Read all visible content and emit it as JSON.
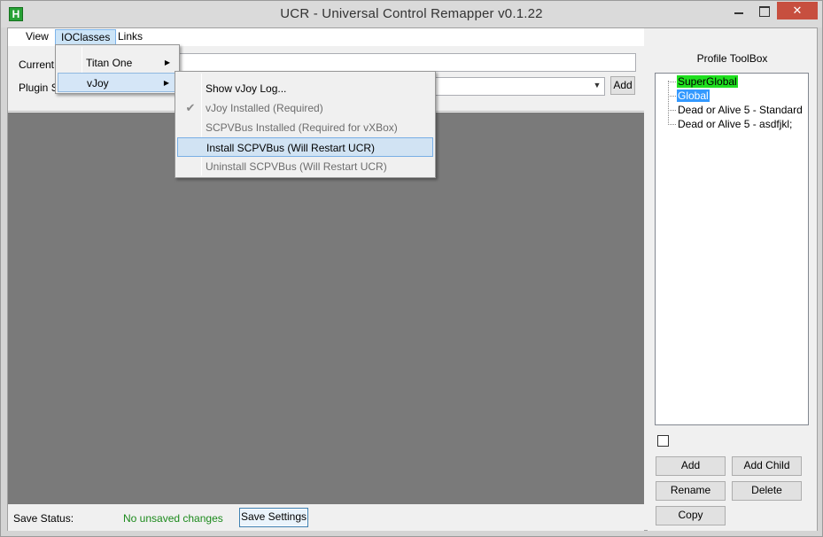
{
  "window": {
    "title": "UCR - Universal Control Remapper v0.1.22",
    "icon_letter": "H",
    "close_glyph": "✕"
  },
  "menu": {
    "items": [
      {
        "label": "View"
      },
      {
        "label": "IOClasses"
      },
      {
        "label": "Links"
      }
    ]
  },
  "top_panel": {
    "current_label": "Current P",
    "plugin_label": "Plugin Se",
    "add_label": "Add"
  },
  "ioclasses_menu": {
    "items": [
      {
        "label": "Titan One",
        "arrow": "▶"
      },
      {
        "label": "vJoy",
        "arrow": "▶"
      }
    ]
  },
  "vjoy_menu": {
    "items": [
      {
        "label": "Show vJoy Log...",
        "enabled": true
      },
      {
        "label": "vJoy Installed (Required)",
        "enabled": false,
        "checked": true,
        "check_glyph": "✔"
      },
      {
        "label": "SCPVBus Installed (Required for vXBox)",
        "enabled": false
      },
      {
        "label": "Install SCPVBus (Will Restart UCR)",
        "enabled": true,
        "highlighted": true
      },
      {
        "label": "Uninstall SCPVBus (Will Restart UCR)",
        "enabled": false
      }
    ]
  },
  "status": {
    "label": "Save Status:",
    "value": "No unsaved changes",
    "save_button": "Save Settings"
  },
  "toolbox": {
    "title": "Profile ToolBox",
    "tree": [
      {
        "label": "SuperGlobal"
      },
      {
        "label": "Global"
      },
      {
        "label": "Dead or Alive 5 - Standard"
      },
      {
        "label": "Dead or Alive 5 - asdfjkl;"
      }
    ],
    "buttons": {
      "add": "Add",
      "add_child": "Add Child",
      "rename": "Rename",
      "delete": "Delete",
      "copy": "Copy"
    }
  },
  "colors": {
    "superglobal_highlight": "#1fe01f",
    "global_highlight": "#3399ff",
    "status_ok": "#1c8a1c",
    "workspace": "#7a7a7a"
  }
}
